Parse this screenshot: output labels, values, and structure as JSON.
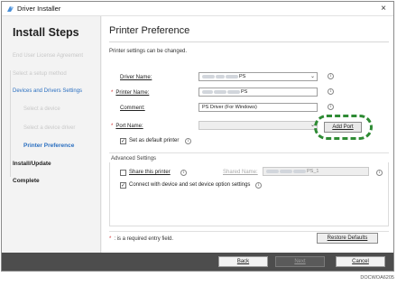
{
  "window": {
    "title": "Driver Installer",
    "close_symbol": "×"
  },
  "sidebar": {
    "title": "Install Steps",
    "steps": [
      {
        "label": "End User License Agreement",
        "state": "done"
      },
      {
        "label": "Select a setup method",
        "state": "done"
      },
      {
        "label": "Devices and Drivers Settings",
        "state": "current-group"
      },
      {
        "label": "Select a device",
        "state": "done"
      },
      {
        "label": "Select a device driver",
        "state": "done"
      },
      {
        "label": "Printer Preference",
        "state": "current"
      },
      {
        "label": "Install/Update",
        "state": "pending"
      },
      {
        "label": "Complete",
        "state": "pending"
      }
    ]
  },
  "main": {
    "title": "Printer Preference",
    "description": "Printer settings can be changed.",
    "driver_name": {
      "label": "Driver Name:",
      "value_suffix": "PS",
      "required": false
    },
    "printer_name": {
      "label": "Printer Name:",
      "value_suffix": "PS",
      "required": true
    },
    "comment": {
      "label": "Comment:",
      "value": "PS Driver (For Windows)",
      "required": false
    },
    "port_name": {
      "label": "Port Name:",
      "value": "",
      "required": true
    },
    "add_port_label": "Add Port",
    "default_printer": {
      "label": "Set as default printer",
      "checked": true
    },
    "advanced": {
      "title": "Advanced Settings",
      "share": {
        "label": "Share this printer",
        "checked": false
      },
      "shared_name": {
        "label": "Shared Name:",
        "value_suffix": "PS_1"
      },
      "connect": {
        "label": "Connect with device and set device option settings",
        "checked": true
      }
    },
    "required_note": ": is a required entry field.",
    "required_marker": "*",
    "restore_label": "Restore Defaults"
  },
  "footer": {
    "back_label": "Back",
    "next_label": "Next",
    "cancel_label": "Cancel"
  },
  "doc_code": "DOCWOA6205",
  "colors": {
    "accent": "#2a6fc0",
    "required": "#d32f2f",
    "highlight_ring": "#2e8b34",
    "footer_bg": "#4d4d4d"
  },
  "icons": [
    "app-icon",
    "close-icon",
    "info-icon",
    "dropdown-arrow-icon",
    "checkmark-icon"
  ]
}
